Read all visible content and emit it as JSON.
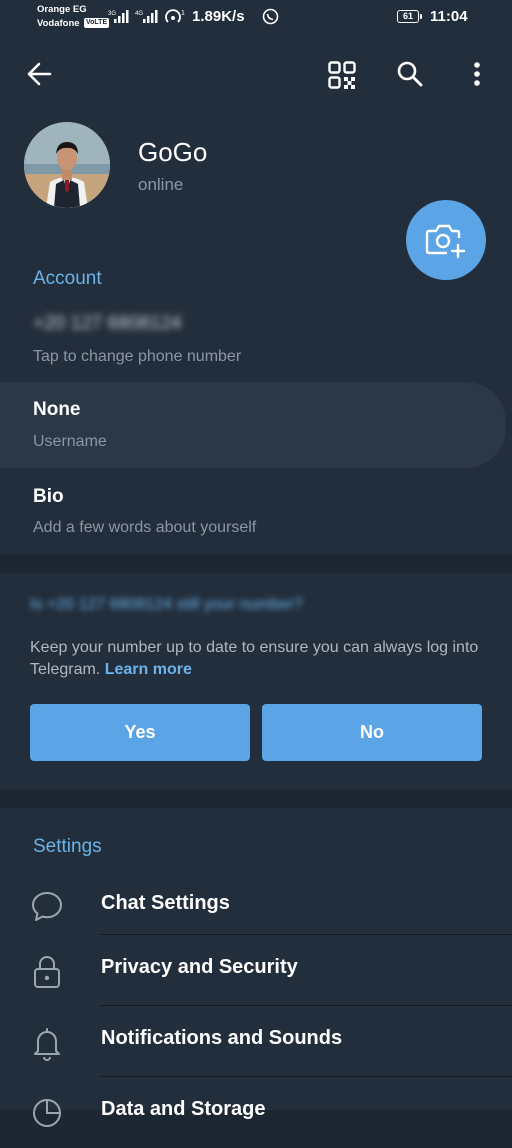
{
  "status_bar": {
    "carrier1": "Orange EG",
    "carrier2": "Vodafone",
    "volte": "VoLTE",
    "net_speed": "1.89K/s",
    "battery": "61",
    "time": "11:04"
  },
  "toolbar": {
    "back_icon": "arrow-left",
    "qr_icon": "qr-code",
    "search_icon": "search",
    "more_icon": "more-vertical"
  },
  "profile": {
    "name": "GoGo",
    "status": "online"
  },
  "account": {
    "title": "Account",
    "phone": "+20 127 6808124",
    "phone_hint": "Tap to change phone number",
    "username": "None",
    "username_label": "Username",
    "bio_label": "Bio",
    "bio_hint": "Add a few words about yourself"
  },
  "number_check": {
    "question": "Is +20 127 6808124 still your number?",
    "text": "Keep your number up to date to ensure you can always log into Telegram.",
    "link": "Learn more",
    "yes": "Yes",
    "no": "No"
  },
  "settings": {
    "title": "Settings",
    "items": [
      {
        "label": "Chat Settings",
        "icon": "chat-bubble"
      },
      {
        "label": "Privacy and Security",
        "icon": "lock"
      },
      {
        "label": "Notifications and Sounds",
        "icon": "bell"
      },
      {
        "label": "Data and Storage",
        "icon": "pie-chart"
      }
    ]
  },
  "colors": {
    "background": "#1d2733",
    "surface": "#232e3c",
    "accent": "#5ba4e5",
    "accent_text": "#6bb3ea",
    "secondary_text": "#8b97a5"
  }
}
